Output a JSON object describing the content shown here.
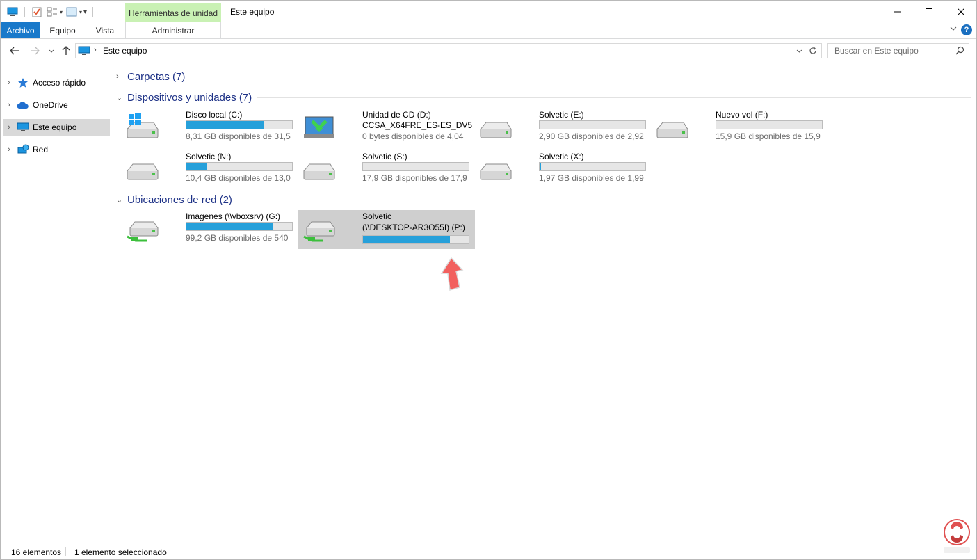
{
  "window": {
    "title": "Este equipo",
    "context_tab_header": "Herramientas de unidad",
    "controls": {
      "minimize": "—",
      "maximize": "☐",
      "close": "✕"
    }
  },
  "ribbon": {
    "tabs": [
      {
        "label": "Archivo"
      },
      {
        "label": "Equipo"
      },
      {
        "label": "Vista"
      }
    ],
    "context_tab": "Administrar",
    "help": "?"
  },
  "address": {
    "location": "Este equipo",
    "search_placeholder": "Buscar en Este equipo"
  },
  "sidebar": {
    "items": [
      {
        "label": "Acceso rápido",
        "icon": "star-icon"
      },
      {
        "label": "OneDrive",
        "icon": "cloud-icon"
      },
      {
        "label": "Este equipo",
        "icon": "computer-icon",
        "selected": true
      },
      {
        "label": "Red",
        "icon": "network-icon"
      }
    ]
  },
  "groups": {
    "folders": {
      "title": "Carpetas (7)",
      "expanded": false
    },
    "devices": {
      "title": "Dispositivos y unidades (7)",
      "expanded": true
    },
    "network": {
      "title": "Ubicaciones de red (2)",
      "expanded": true
    }
  },
  "drives": [
    {
      "name": "Disco local (C:)",
      "free": "8,31 GB disponibles de 31,5",
      "used_fraction": 0.736,
      "icon": "windows-drive-icon"
    },
    {
      "name": "Unidad de CD (D:)",
      "name2": "CCSA_X64FRE_ES-ES_DV5",
      "free": "0 bytes disponibles de 4,04",
      "icon": "cd-drive-icon"
    },
    {
      "name": "Solvetic (E:)",
      "free": "2,90 GB disponibles de 2,92",
      "used_fraction": 0.007,
      "icon": "drive-icon"
    },
    {
      "name": "Nuevo vol (F:)",
      "free": "15,9 GB disponibles de 15,9",
      "used_fraction": 0.0,
      "icon": "drive-icon"
    },
    {
      "name": "Solvetic (N:)",
      "free": "10,4 GB disponibles de 13,0",
      "used_fraction": 0.2,
      "icon": "drive-icon"
    },
    {
      "name": "Solvetic (S:)",
      "free": "17,9 GB disponibles de 17,9",
      "used_fraction": 0.0,
      "icon": "drive-icon"
    },
    {
      "name": "Solvetic (X:)",
      "free": "1,97 GB disponibles de 1,99",
      "used_fraction": 0.01,
      "icon": "drive-icon"
    }
  ],
  "network_drives": [
    {
      "name": "Imagenes (\\\\vboxsrv) (G:)",
      "free": "99,2 GB disponibles de 540",
      "used_fraction": 0.816,
      "icon": "network-drive-icon"
    },
    {
      "name": "Solvetic",
      "name2": "(\\\\DESKTOP-AR3O55I) (P:)",
      "used_fraction": 0.82,
      "selected": true,
      "icon": "network-drive-icon"
    }
  ],
  "status": {
    "count": "16 elementos",
    "selection": "1 elemento seleccionado"
  },
  "colors": {
    "accent": "#1979ca",
    "context_tab": "#c9f1b4",
    "bar_fill": "#26a0da",
    "group_title": "#1e3287",
    "annotation_arrow": "#f2605e"
  }
}
